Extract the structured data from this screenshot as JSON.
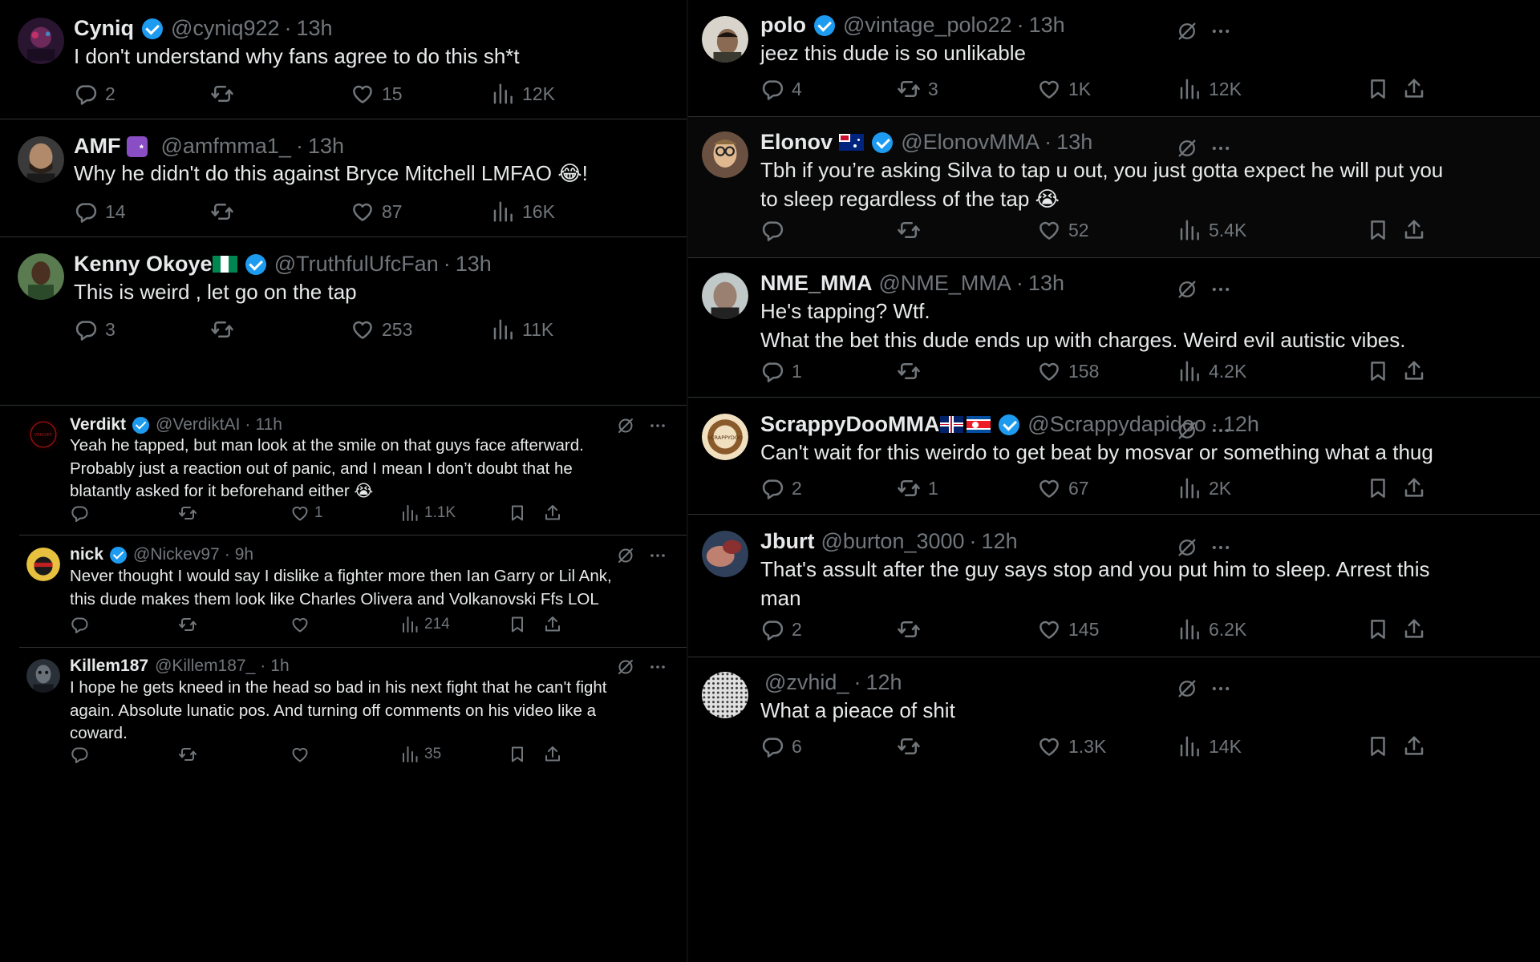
{
  "left_column": {
    "tweets": [
      {
        "name": "Cyniq",
        "verified": true,
        "handle": "@cyniq922",
        "separator": "·",
        "time": "13h",
        "text_lines": [
          "I don't understand why fans agree to do this sh*t"
        ],
        "stats": {
          "replies": "2",
          "retweets": "",
          "likes": "15",
          "views": "12K"
        }
      },
      {
        "name": "AMF",
        "badge": "crescent-badge",
        "handle": "@amfmma1_",
        "separator": "·",
        "time": "13h",
        "text_lines": [
          "Why he didn't do this against Bryce Mitchell LMFAO 😂!"
        ],
        "stats": {
          "replies": "14",
          "retweets": "",
          "likes": "87",
          "views": "16K"
        }
      },
      {
        "name": "Kenny Okoye",
        "flag": "nigeria-flag",
        "verified": true,
        "handle": "@TruthfulUfcFan",
        "separator": "·",
        "time": "13h",
        "text_lines": [
          "This is weird , let go on the tap"
        ],
        "stats": {
          "replies": "3",
          "retweets": "",
          "likes": "253",
          "views": "11K"
        }
      },
      {
        "name": "Verdikt",
        "verified": true,
        "handle": "@VerdiktAI",
        "separator": "·",
        "time": "11h",
        "text_lines": [
          "Yeah he tapped, but man look at the smile on that guys face afterward.",
          "Probably just a reaction out of panic, and I mean I don’t doubt that he",
          "blatantly asked for it beforehand either 😭"
        ],
        "stats": {
          "replies": "",
          "retweets": "",
          "likes": "1",
          "views": "1.1K"
        }
      },
      {
        "name": "nick",
        "verified": true,
        "handle": "@Nickev97",
        "separator": "·",
        "time": "9h",
        "text_lines": [
          "Never thought I would say I dislike a fighter more then Ian Garry or Lil Ank,",
          "this dude makes them look like Charles Olivera  and Volkanovski Ffs LOL"
        ],
        "stats": {
          "replies": "",
          "retweets": "",
          "likes": "",
          "views": "214"
        }
      },
      {
        "name": "Killem187",
        "handle": "@Killem187_",
        "separator": "·",
        "time": "1h",
        "text_lines": [
          "I hope he gets kneed in the head so bad in his next fight that he can't fight",
          "again. Absolute lunatic pos. And turning off comments on his video like a",
          "coward."
        ],
        "stats": {
          "replies": "",
          "retweets": "",
          "likes": "",
          "views": "35"
        }
      }
    ]
  },
  "right_column": {
    "tweets": [
      {
        "name": "polo",
        "verified": true,
        "handle": "@vintage_polo22",
        "separator": "·",
        "time": "13h",
        "text_lines": [
          "jeez this dude is so unlikable"
        ],
        "stats": {
          "replies": "4",
          "retweets": "3",
          "likes": "1K",
          "views": "12K"
        }
      },
      {
        "name": "Elonov",
        "flag": "australia-flag",
        "verified": true,
        "handle": "@ElonovMMA",
        "separator": "·",
        "time": "13h",
        "text_lines": [
          "Tbh if you’re asking Silva to tap u out, you just gotta expect he will put you",
          "to sleep regardless of the tap 😭"
        ],
        "stats": {
          "replies": "",
          "retweets": "",
          "likes": "52",
          "views": "5.4K"
        }
      },
      {
        "name": "NME_MMA",
        "handle": "@NME_MMA",
        "separator": "·",
        "time": "13h",
        "text_lines": [
          "He's tapping? Wtf.",
          "What the bet this dude ends up with charges. Weird evil autistic vibes."
        ],
        "stats": {
          "replies": "1",
          "retweets": "",
          "likes": "158",
          "views": "4.2K"
        }
      },
      {
        "name": "ScrappyDooMMA",
        "flag": "uk-northkorea-flags",
        "verified": true,
        "handle": "@Scrappydapidoo",
        "separator": "·",
        "time": "12h",
        "text_lines": [
          "Can't wait for this weirdo to get beat by mosvar or something what a thug"
        ],
        "stats": {
          "replies": "2",
          "retweets": "1",
          "likes": "67",
          "views": "2K"
        }
      },
      {
        "name": "Jburt",
        "handle": "@burton_3000",
        "separator": "·",
        "time": "12h",
        "text_lines": [
          "That's assult after the guy says stop and you put him to sleep. Arrest this",
          "man"
        ],
        "stats": {
          "replies": "2",
          "retweets": "",
          "likes": "145",
          "views": "6.2K"
        }
      },
      {
        "name": "",
        "handle": "@zvhid_",
        "separator": "·",
        "time": "12h",
        "text_lines": [
          "What a pieace of shit"
        ],
        "stats": {
          "replies": "6",
          "retweets": "",
          "likes": "1.3K",
          "views": "14K"
        }
      }
    ]
  },
  "icons": {
    "reply": "reply-icon",
    "retweet": "retweet-icon",
    "like": "heart-icon",
    "views": "views-chart-icon",
    "bookmark": "bookmark-icon",
    "share": "share-icon",
    "grok": "grok-icon",
    "more": "more-icon"
  },
  "colors": {
    "background": "#000000",
    "text": "#e7e9ea",
    "secondary": "#71767b",
    "divider": "#2f3336",
    "verified": "#1d9bf0"
  }
}
